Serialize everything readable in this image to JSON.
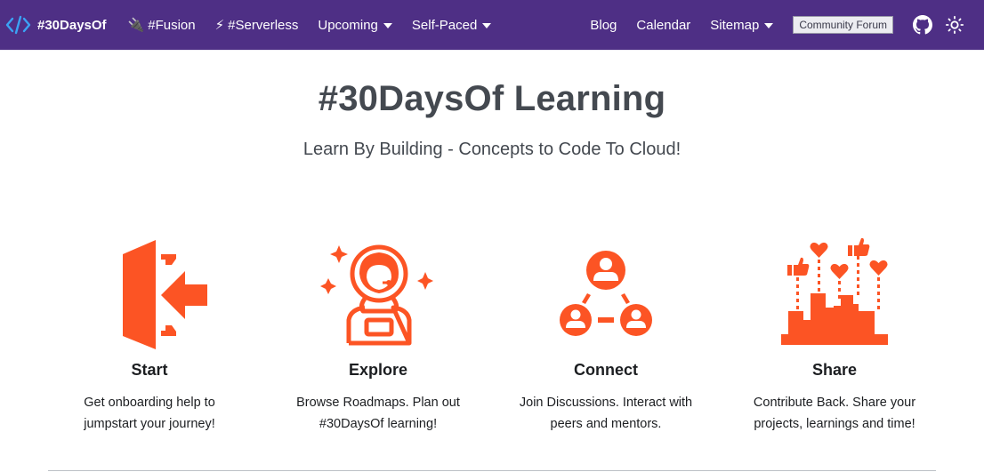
{
  "navbar": {
    "brand": {
      "title": "#30DaysOf",
      "icon": "code-brackets-icon"
    },
    "left_items": [
      {
        "label": "#Fusion",
        "emoji": "🔌",
        "icon": "plug-icon"
      },
      {
        "label": "#Serverless",
        "emoji": "⚡",
        "icon": "lightning-icon"
      },
      {
        "label": "Upcoming",
        "dropdown": true
      },
      {
        "label": "Self-Paced",
        "dropdown": true
      }
    ],
    "right_items": [
      {
        "label": "Blog"
      },
      {
        "label": "Calendar"
      },
      {
        "label": "Sitemap",
        "dropdown": true
      }
    ],
    "forum_button": "Community Forum",
    "github_icon": "github-icon",
    "theme_toggle_icon": "sun-icon"
  },
  "hero": {
    "title": "#30DaysOf Learning",
    "subtitle": "Learn By Building - Concepts to Code To Cloud!"
  },
  "features": [
    {
      "title": "Start",
      "desc_line1": "Get onboarding help to",
      "desc_line2": "jumpstart your journey!",
      "icon": "sign-in-door-icon"
    },
    {
      "title": "Explore",
      "desc_line1": "Browse Roadmaps. Plan out",
      "desc_line2": "#30DaysOf learning!",
      "icon": "astronaut-icon"
    },
    {
      "title": "Connect",
      "desc_line1": "Join Discussions. Interact with",
      "desc_line2": "peers and mentors.",
      "icon": "network-people-icon"
    },
    {
      "title": "Share",
      "desc_line1": "Contribute Back. Share your",
      "desc_line2": "projects, learnings and time!",
      "icon": "social-engagement-icon"
    }
  ],
  "colors": {
    "navbar_bg": "#4e2f85",
    "accent_orange": "#fc5424",
    "logo_blue": "#2f9ff5",
    "heading_gray": "#444950"
  }
}
